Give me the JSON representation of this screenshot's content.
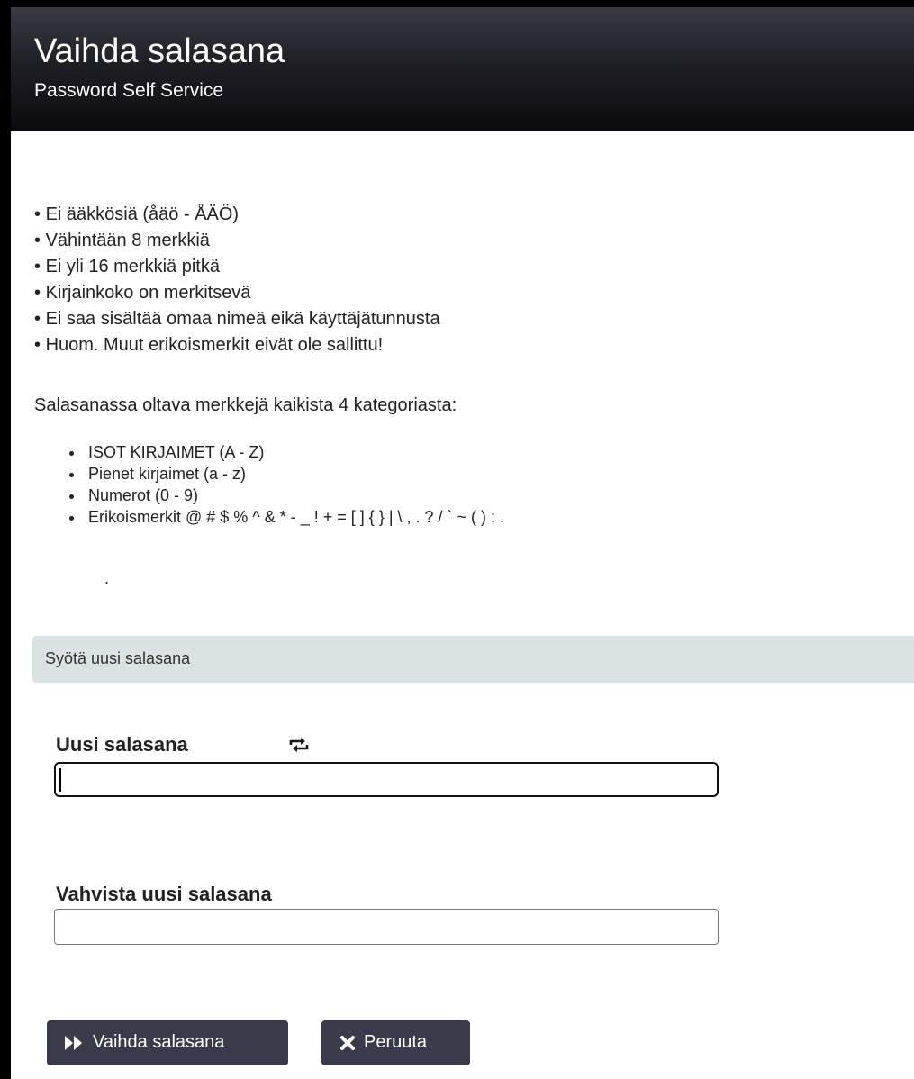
{
  "header": {
    "title": "Vaihda salasana",
    "subtitle": "Password Self Service"
  },
  "rules": [
    "Ei ääkkösiä (åäö - ÅÄÖ)",
    "Vähintään 8 merkkiä",
    "Ei yli 16 merkkiä pitkä",
    "Kirjainkoko on merkitsevä",
    "Ei saa sisältää omaa nimeä eikä käyttäjätunnusta",
    "Huom. Muut erikoismerkit eivät ole sallittu!"
  ],
  "categories_intro": "Salasanassa oltava merkkejä kaikista 4 kategoriasta:",
  "categories": [
    "ISOT KIRJAIMET (A - Z)",
    "Pienet kirjaimet (a - z)",
    "Numerot (0 - 9)",
    "Erikoismerkit @ # $ % ^ & * - _ ! + = [ ] { } | \\ , . ? / ` ~ ( ) ; ."
  ],
  "trailing_dot": ".",
  "section": {
    "title": "Syötä uusi salasana"
  },
  "new_password": {
    "label": "Uusi salasana",
    "value": "",
    "icon": "refresh-icon"
  },
  "confirm_password": {
    "label": "Vahvista uusi salasana",
    "value": ""
  },
  "buttons": {
    "submit": {
      "label": "Vaihda salasana",
      "icon": "fast-forward-icon"
    },
    "cancel": {
      "label": "Peruuta",
      "icon": "close-icon"
    }
  },
  "colors": {
    "header_bg": "#1f1f26",
    "section_bar_bg": "#d9e3e2",
    "button_bg": "#3a3a4a"
  }
}
